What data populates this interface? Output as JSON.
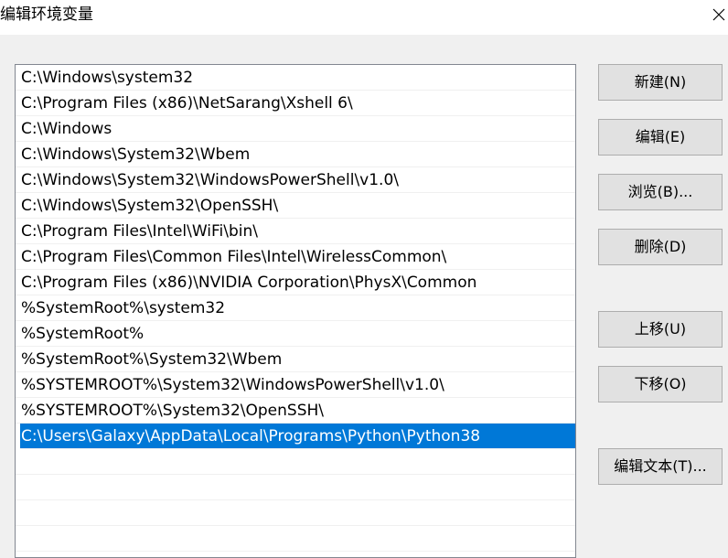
{
  "window": {
    "title": "编辑环境变量",
    "close_icon": "close-icon"
  },
  "path_list": {
    "items": [
      "C:\\Windows\\system32",
      "C:\\Program Files (x86)\\NetSarang\\Xshell 6\\",
      "C:\\Windows",
      "C:\\Windows\\System32\\Wbem",
      "C:\\Windows\\System32\\WindowsPowerShell\\v1.0\\",
      "C:\\Windows\\System32\\OpenSSH\\",
      "C:\\Program Files\\Intel\\WiFi\\bin\\",
      "C:\\Program Files\\Common Files\\Intel\\WirelessCommon\\",
      "C:\\Program Files (x86)\\NVIDIA Corporation\\PhysX\\Common",
      "%SystemRoot%\\system32",
      "%SystemRoot%",
      "%SystemRoot%\\System32\\Wbem",
      "%SYSTEMROOT%\\System32\\WindowsPowerShell\\v1.0\\",
      "%SYSTEMROOT%\\System32\\OpenSSH\\",
      "C:\\Users\\Galaxy\\AppData\\Local\\Programs\\Python\\Python38"
    ],
    "selected_index": 14,
    "selection_color": "#0078d7"
  },
  "buttons": {
    "new": "新建(N)",
    "edit": "编辑(E)",
    "browse": "浏览(B)...",
    "delete": "删除(D)",
    "move_up": "上移(U)",
    "move_down": "下移(O)",
    "edit_text": "编辑文本(T)..."
  }
}
